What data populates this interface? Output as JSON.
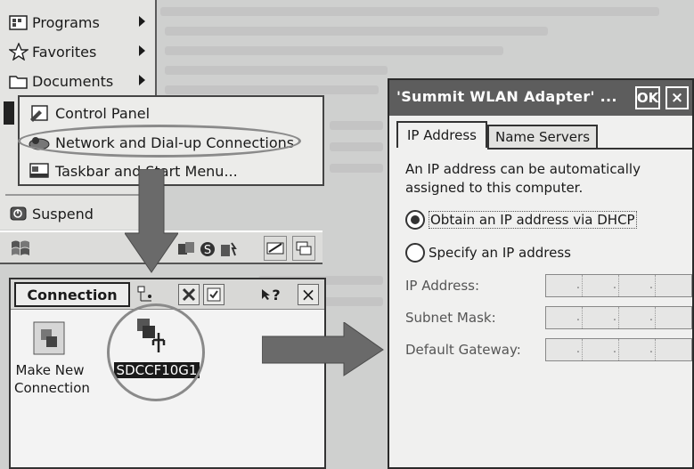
{
  "start_menu": {
    "items": [
      {
        "label": "Programs",
        "icon": "programs-icon",
        "has_submenu": true
      },
      {
        "label": "Favorites",
        "icon": "star-icon",
        "has_submenu": true
      },
      {
        "label": "Documents",
        "icon": "folder-icon",
        "has_submenu": true
      },
      {
        "label": "Suspend",
        "icon": "suspend-icon",
        "has_submenu": false
      }
    ],
    "submenu": [
      {
        "label": "Control Panel",
        "icon": "control-panel-icon"
      },
      {
        "label": "Network and Dial-up Connections",
        "icon": "network-icon"
      },
      {
        "label": "Taskbar and Start Menu...",
        "icon": "taskbar-icon"
      }
    ]
  },
  "taskbar": {
    "tray_icons": [
      "network-tray-icon",
      "shield-tray-icon",
      "battery-tray-icon",
      "keyboard-icon",
      "windows-switch-icon"
    ]
  },
  "connection_window": {
    "title": "Connection",
    "toolbar": [
      "details-icon",
      "delete-icon",
      "properties-icon",
      "help-icon",
      "close-icon"
    ],
    "help_label": "?",
    "close_label": "×",
    "items": [
      {
        "label_line1": "Make New",
        "label_line2": "Connection",
        "icon": "make-connection-icon",
        "selected": false
      },
      {
        "label_line1": "SDCCF10G1",
        "label_line2": "",
        "icon": "wlan-adapter-icon",
        "selected": true
      }
    ]
  },
  "dialog": {
    "title": "'Summit WLAN Adapter' ...",
    "ok_label": "OK",
    "close_label": "×",
    "tabs": [
      {
        "label": "IP Address",
        "active": true
      },
      {
        "label": "Name Servers",
        "active": false
      }
    ],
    "description": "An IP address can be automatically assigned to this computer.",
    "options": [
      {
        "label": "Obtain an IP address via DHCP",
        "selected": true
      },
      {
        "label": "Specify an IP address",
        "selected": false
      }
    ],
    "fields": [
      {
        "label": "IP Address:",
        "value": ""
      },
      {
        "label": "Subnet Mask:",
        "value": ""
      },
      {
        "label": "Default Gateway:",
        "value": ""
      }
    ]
  },
  "colors": {
    "dialog_title_bg": "#5d5d5d",
    "selection_bg": "#1a1a1a",
    "highlight_ring": "#8a8a8a"
  }
}
